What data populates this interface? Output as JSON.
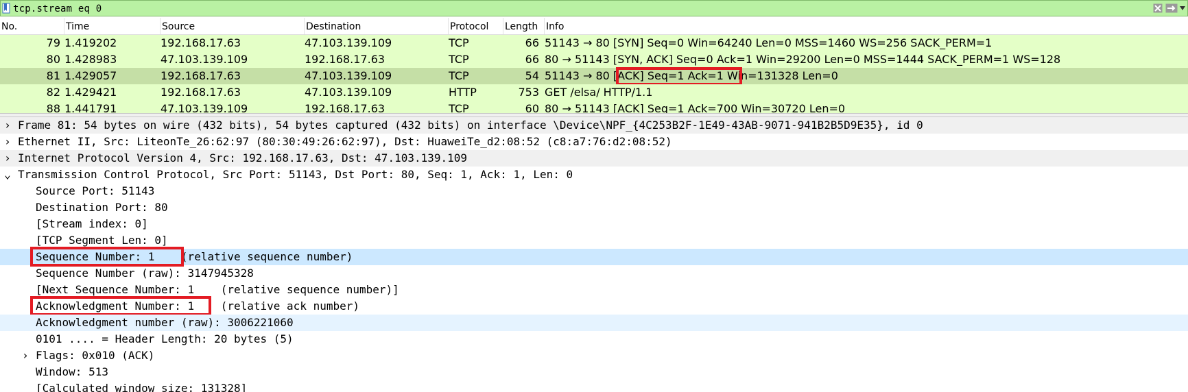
{
  "filter": {
    "value": "tcp.stream eq 0",
    "clear_label": "✕",
    "apply_label": "→"
  },
  "columns": [
    "No.",
    "Time",
    "Source",
    "Destination",
    "Protocol",
    "Length",
    "Info"
  ],
  "packets": [
    {
      "no": "79",
      "time": "1.419202",
      "src": "192.168.17.63",
      "dst": "47.103.139.109",
      "proto": "TCP",
      "len": "66",
      "info": "51143 → 80 [SYN] Seq=0 Win=64240 Len=0 MSS=1460 WS=256 SACK_PERM=1"
    },
    {
      "no": "80",
      "time": "1.428983",
      "src": "47.103.139.109",
      "dst": "192.168.17.63",
      "proto": "TCP",
      "len": "66",
      "info": "80 → 51143 [SYN, ACK] Seq=0 Ack=1 Win=29200 Len=0 MSS=1444 SACK_PERM=1 WS=128"
    },
    {
      "no": "81",
      "time": "1.429057",
      "src": "192.168.17.63",
      "dst": "47.103.139.109",
      "proto": "TCP",
      "len": "54",
      "info": "51143 → 80 [ACK] Seq=1 Ack=1 Win=131328 Len=0"
    },
    {
      "no": "82",
      "time": "1.429421",
      "src": "192.168.17.63",
      "dst": "47.103.139.109",
      "proto": "HTTP",
      "len": "753",
      "info": "GET /elsa/ HTTP/1.1"
    },
    {
      "no": "88",
      "time": "1.441791",
      "src": "47.103.139.109",
      "dst": "192.168.17.63",
      "proto": "TCP",
      "len": "60",
      "info": "80 → 51143 [ACK] Seq=1 Ack=700 Win=30720 Len=0"
    }
  ],
  "details": [
    {
      "text": "Frame 81: 54 bytes on wire (432 bits), 54 bytes captured (432 bits) on interface \\Device\\NPF_{4C253B2F-1E49-43AB-9071-941B2B5D9E35}, id 0",
      "arrow": "›"
    },
    {
      "text": "Ethernet II, Src: LiteonTe_26:62:97 (80:30:49:26:62:97), Dst: HuaweiTe_d2:08:52 (c8:a7:76:d2:08:52)",
      "arrow": "›"
    },
    {
      "text": "Internet Protocol Version 4, Src: 192.168.17.63, Dst: 47.103.139.109",
      "arrow": "›"
    },
    {
      "text": "Transmission Control Protocol, Src Port: 51143, Dst Port: 80, Seq: 1, Ack: 1, Len: 0",
      "arrow": "⌄"
    },
    {
      "text": "Source Port: 51143"
    },
    {
      "text": "Destination Port: 80"
    },
    {
      "text": "[Stream index: 0]"
    },
    {
      "text": "[TCP Segment Len: 0]"
    },
    {
      "text": "Sequence Number: 1    (relative sequence number)"
    },
    {
      "text": "Sequence Number (raw): 3147945328"
    },
    {
      "text": "[Next Sequence Number: 1    (relative sequence number)]"
    },
    {
      "text": "Acknowledgment Number: 1    (relative ack number)"
    },
    {
      "text": "Acknowledgment number (raw): 3006221060"
    },
    {
      "text": "0101 .... = Header Length: 20 bytes (5)"
    },
    {
      "text": "Flags: 0x010 (ACK)",
      "arrow": "›"
    },
    {
      "text": "Window: 513"
    },
    {
      "text": "[Calculated window size: 131328]"
    }
  ],
  "colors": {
    "filter_bg": "#b9f1a3",
    "row_bg": "#e4ffc7",
    "row_selected_bg": "#c5dfa6",
    "detail_selected_bg": "#cce8ff",
    "highlight_box": "#e31b23"
  }
}
